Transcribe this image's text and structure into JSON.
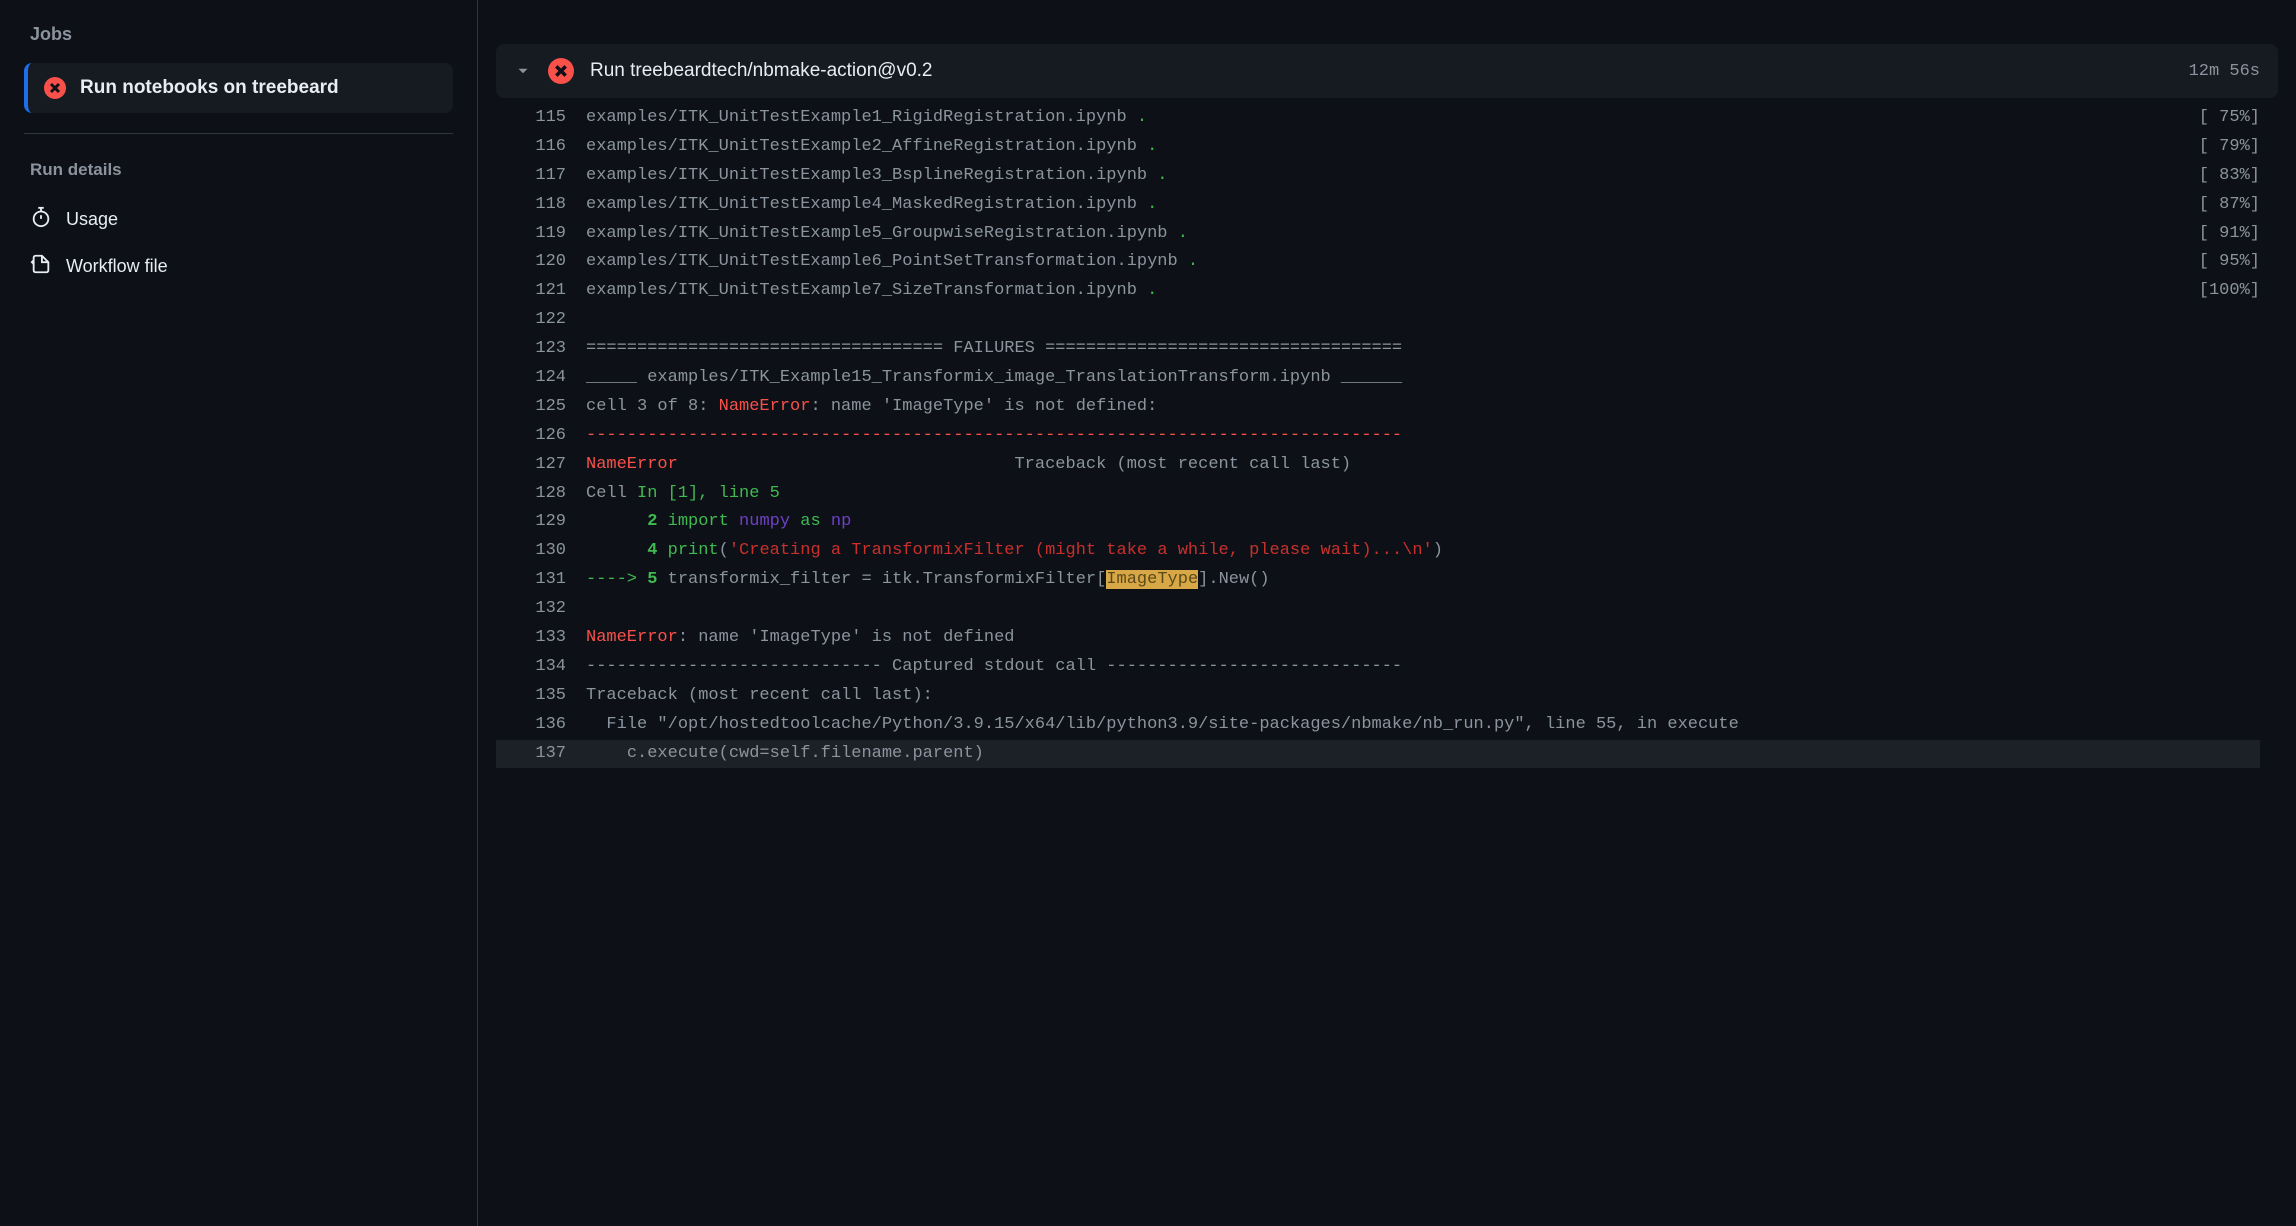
{
  "sidebar": {
    "jobs_heading": "Jobs",
    "job_label": "Run notebooks on treebeard",
    "run_details_heading": "Run details",
    "usage_label": "Usage",
    "workflow_file_label": "Workflow file"
  },
  "step": {
    "title": "Run treebeardtech/nbmake-action@v0.2",
    "duration": "12m 56s"
  },
  "log_lines": [
    {
      "n": "115",
      "segments": [
        {
          "t": "examples/ITK_UnitTestExample1_RigidRegistration.ipynb ",
          "c": ""
        },
        {
          "t": ".",
          "c": "c-green"
        }
      ],
      "right": "[ 75%]"
    },
    {
      "n": "116",
      "segments": [
        {
          "t": "examples/ITK_UnitTestExample2_AffineRegistration.ipynb ",
          "c": ""
        },
        {
          "t": ".",
          "c": "c-green"
        }
      ],
      "right": "[ 79%]"
    },
    {
      "n": "117",
      "segments": [
        {
          "t": "examples/ITK_UnitTestExample3_BsplineRegistration.ipynb ",
          "c": ""
        },
        {
          "t": ".",
          "c": "c-green"
        }
      ],
      "right": "[ 83%]"
    },
    {
      "n": "118",
      "segments": [
        {
          "t": "examples/ITK_UnitTestExample4_MaskedRegistration.ipynb ",
          "c": ""
        },
        {
          "t": ".",
          "c": "c-green"
        }
      ],
      "right": "[ 87%]"
    },
    {
      "n": "119",
      "segments": [
        {
          "t": "examples/ITK_UnitTestExample5_GroupwiseRegistration.ipynb ",
          "c": ""
        },
        {
          "t": ".",
          "c": "c-green"
        }
      ],
      "right": "[ 91%]"
    },
    {
      "n": "120",
      "segments": [
        {
          "t": "examples/ITK_UnitTestExample6_PointSetTransformation.ipynb ",
          "c": ""
        },
        {
          "t": ".",
          "c": "c-green"
        }
      ],
      "right": "[ 95%]"
    },
    {
      "n": "121",
      "segments": [
        {
          "t": "examples/ITK_UnitTestExample7_SizeTransformation.ipynb ",
          "c": ""
        },
        {
          "t": ".",
          "c": "c-green"
        }
      ],
      "right": "[100%]"
    },
    {
      "n": "122",
      "segments": []
    },
    {
      "n": "123",
      "segments": [
        {
          "t": "=================================== FAILURES ===================================",
          "c": ""
        }
      ]
    },
    {
      "n": "124",
      "segments": [
        {
          "t": "_____ examples/ITK_Example15_Transformix_image_TranslationTransform.ipynb ______",
          "c": ""
        }
      ]
    },
    {
      "n": "125",
      "segments": [
        {
          "t": "cell 3 of 8: ",
          "c": ""
        },
        {
          "t": "NameError",
          "c": "c-red"
        },
        {
          "t": ": name 'ImageType' is not defined:",
          "c": ""
        }
      ]
    },
    {
      "n": "126",
      "segments": [
        {
          "t": "--------------------------------------------------------------------------------",
          "c": "c-red"
        }
      ]
    },
    {
      "n": "127",
      "segments": [
        {
          "t": "NameError",
          "c": "c-red"
        },
        {
          "t": "                                 Traceback (most recent call last)",
          "c": ""
        }
      ]
    },
    {
      "n": "128",
      "segments": [
        {
          "t": "Cell ",
          "c": ""
        },
        {
          "t": "In [1], line 5",
          "c": "c-green"
        }
      ]
    },
    {
      "n": "129",
      "segments": [
        {
          "t": "      ",
          "c": ""
        },
        {
          "t": "2",
          "c": "c-bold-green"
        },
        {
          "t": " ",
          "c": ""
        },
        {
          "t": "import",
          "c": "c-green"
        },
        {
          "t": " ",
          "c": ""
        },
        {
          "t": "numpy",
          "c": "c-purple"
        },
        {
          "t": " ",
          "c": ""
        },
        {
          "t": "as",
          "c": "c-green"
        },
        {
          "t": " ",
          "c": ""
        },
        {
          "t": "np",
          "c": "c-purple"
        }
      ]
    },
    {
      "n": "130",
      "segments": [
        {
          "t": "      ",
          "c": ""
        },
        {
          "t": "4",
          "c": "c-bold-green"
        },
        {
          "t": " ",
          "c": ""
        },
        {
          "t": "print",
          "c": "c-green"
        },
        {
          "t": "(",
          "c": ""
        },
        {
          "t": "'Creating a TransformixFilter (might take a while, please wait)...\\n'",
          "c": "c-red-dim"
        },
        {
          "t": ")",
          "c": ""
        }
      ]
    },
    {
      "n": "131",
      "segments": [
        {
          "t": "----> ",
          "c": "c-green"
        },
        {
          "t": "5",
          "c": "c-bold-green"
        },
        {
          "t": " transformix_filter ",
          "c": ""
        },
        {
          "t": "=",
          "c": ""
        },
        {
          "t": " itk",
          "c": ""
        },
        {
          "t": ".",
          "c": ""
        },
        {
          "t": "TransformixFilter[",
          "c": ""
        },
        {
          "t": "ImageType",
          "c": "highlight-token"
        },
        {
          "t": "]",
          "c": ""
        },
        {
          "t": ".",
          "c": ""
        },
        {
          "t": "New()",
          "c": ""
        }
      ]
    },
    {
      "n": "132",
      "segments": []
    },
    {
      "n": "133",
      "segments": [
        {
          "t": "NameError",
          "c": "c-red"
        },
        {
          "t": ": name 'ImageType' is not defined",
          "c": ""
        }
      ]
    },
    {
      "n": "134",
      "segments": [
        {
          "t": "----------------------------- Captured stdout call -----------------------------",
          "c": ""
        }
      ]
    },
    {
      "n": "135",
      "segments": [
        {
          "t": "Traceback (most recent call last):",
          "c": ""
        }
      ]
    },
    {
      "n": "136",
      "segments": [
        {
          "t": "  File \"/opt/hostedtoolcache/Python/3.9.15/x64/lib/python3.9/site-packages/nbmake/nb_run.py\", line 55, in execute",
          "c": ""
        }
      ]
    },
    {
      "n": "137",
      "segments": [
        {
          "t": "    c.execute(cwd=self.filename.parent)",
          "c": ""
        }
      ],
      "hover": true
    }
  ]
}
